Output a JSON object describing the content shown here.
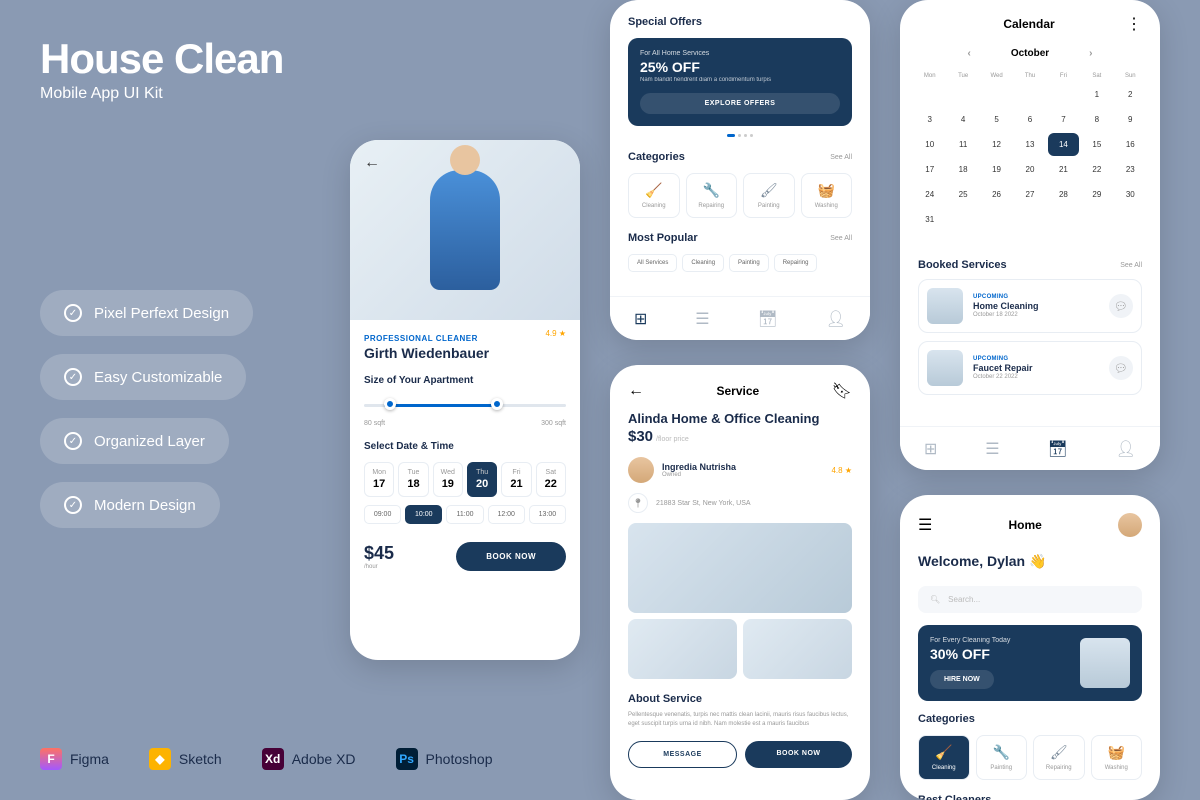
{
  "hero": {
    "title": "House Clean",
    "subtitle": "Mobile App UI Kit"
  },
  "features": [
    "Pixel Perfext Design",
    "Easy Customizable",
    "Organized Layer",
    "Modern Design"
  ],
  "tools": [
    "Figma",
    "Sketch",
    "Adobe XD",
    "Photoshop"
  ],
  "p1": {
    "tag": "PROFESSIONAL CLEANER",
    "name": "Girth Wiedenbauer",
    "rating": "4.9 ★",
    "size_label": "Size of Your Apartment",
    "slider_min": "80 sqft",
    "slider_max": "300 sqft",
    "date_label": "Select Date & Time",
    "days": [
      {
        "name": "Mon",
        "num": "17"
      },
      {
        "name": "Tue",
        "num": "18"
      },
      {
        "name": "Wed",
        "num": "19"
      },
      {
        "name": "Thu",
        "num": "20",
        "active": true
      },
      {
        "name": "Fri",
        "num": "21"
      },
      {
        "name": "Sat",
        "num": "22"
      }
    ],
    "times": [
      "09:00",
      "10:00",
      "11:00",
      "12:00",
      "13:00"
    ],
    "time_active_index": 1,
    "price": "$45",
    "price_sub": "/hour",
    "book": "BOOK NOW"
  },
  "p2": {
    "special": "Special Offers",
    "offer_sub": "For All Home Services",
    "offer_big": "25% OFF",
    "offer_desc": "Nam blandit hendrerit diam a condimentum turpis",
    "offer_btn": "EXPLORE OFFERS",
    "categories": "Categories",
    "see_all": "See All",
    "cats": [
      "Cleaning",
      "Repairing",
      "Painting",
      "Washing"
    ],
    "popular": "Most Popular",
    "chips": [
      "All Services",
      "Cleaning",
      "Painting",
      "Repairing"
    ]
  },
  "p3": {
    "title": "Service",
    "name": "Alinda Home & Office Cleaning",
    "price": "$30",
    "price_sub": "/floor price",
    "owner": "Ingredia Nutrisha",
    "owner_sub": "Owned",
    "rating": "4.8 ★",
    "location": "21883 Star St, New York, USA",
    "about": "About Service",
    "about_text": "Pellentesque venenatis, turpis nec mattis clean lacinii, mauris risus faucibus lectus, eget suscipit turpis urna id nibh. Nam molestie est a mauris faucibus",
    "msg": "MESSAGE",
    "book": "BOOK NOW"
  },
  "p4": {
    "title": "Calendar",
    "month": "October",
    "dh": [
      "Mon",
      "Tue",
      "Wed",
      "Thu",
      "Fri",
      "Sat",
      "Sun"
    ],
    "days": [
      "",
      "",
      "",
      "",
      "",
      "1",
      "2",
      "3",
      "4",
      "5",
      "6",
      "7",
      "8",
      "9",
      "10",
      "11",
      "12",
      "13",
      "14",
      "15",
      "16",
      "17",
      "18",
      "19",
      "20",
      "21",
      "22",
      "23",
      "24",
      "25",
      "26",
      "27",
      "28",
      "29",
      "30",
      "31"
    ],
    "active_day": "14",
    "booked": "Booked Services",
    "see_all": "See All",
    "items": [
      {
        "tag": "UPCOMING",
        "name": "Home Cleaning",
        "date": "October 18 2022"
      },
      {
        "tag": "UPCOMING",
        "name": "Faucet Repair",
        "date": "October 22 2022"
      }
    ]
  },
  "p5": {
    "title": "Home",
    "welcome": "Welcome, Dylan 👋",
    "search": "Search...",
    "promo_sub": "For Every Cleaning Today",
    "promo_big": "30% OFF",
    "hire": "HIRE NOW",
    "categories": "Categories",
    "cats": [
      "Cleaning",
      "Painting",
      "Repairing",
      "Washing"
    ],
    "best": "Best Cleaners"
  }
}
